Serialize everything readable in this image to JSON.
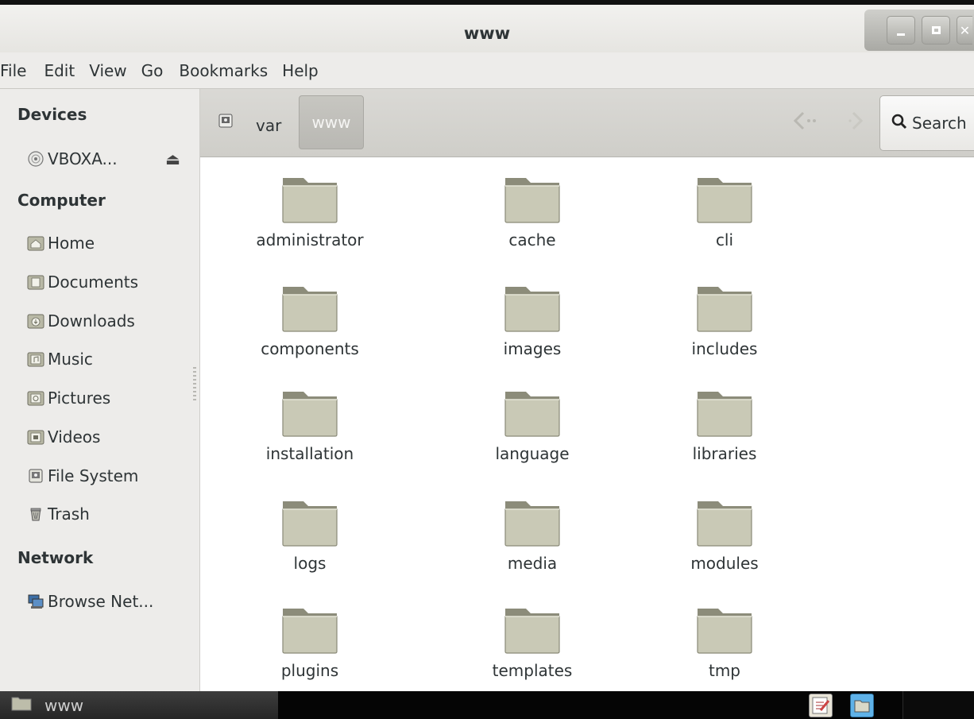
{
  "window": {
    "title": "www"
  },
  "menubar": {
    "items": [
      "File",
      "Edit",
      "View",
      "Go",
      "Bookmarks",
      "Help"
    ]
  },
  "sidebar": {
    "sections": [
      {
        "heading": "Devices",
        "items": [
          {
            "label": "VBOXA...",
            "icon": "disc-icon",
            "eject": "⏏"
          }
        ]
      },
      {
        "heading": "Computer",
        "items": [
          {
            "label": "Home",
            "icon": "home-folder-icon"
          },
          {
            "label": "Documents",
            "icon": "documents-folder-icon"
          },
          {
            "label": "Downloads",
            "icon": "downloads-folder-icon"
          },
          {
            "label": "Music",
            "icon": "music-folder-icon"
          },
          {
            "label": "Pictures",
            "icon": "pictures-folder-icon"
          },
          {
            "label": "Videos",
            "icon": "videos-folder-icon"
          },
          {
            "label": "File System",
            "icon": "drive-icon"
          },
          {
            "label": "Trash",
            "icon": "trash-icon"
          }
        ]
      },
      {
        "heading": "Network",
        "items": [
          {
            "label": "Browse Net...",
            "icon": "network-icon"
          }
        ]
      }
    ]
  },
  "pathbar": {
    "crumbs": [
      "var",
      "www"
    ],
    "active": "www"
  },
  "search": {
    "label": "Search"
  },
  "files": [
    "administrator",
    "cache",
    "cli",
    "components",
    "images",
    "includes",
    "installation",
    "language",
    "libraries",
    "logs",
    "media",
    "modules",
    "plugins",
    "templates",
    "tmp"
  ],
  "taskbar": {
    "window_label": "www"
  },
  "colors": {
    "folder_body": "#c9c9b6",
    "folder_tab": "#8c8c7a",
    "accent_tray": "#5fb2e8"
  }
}
